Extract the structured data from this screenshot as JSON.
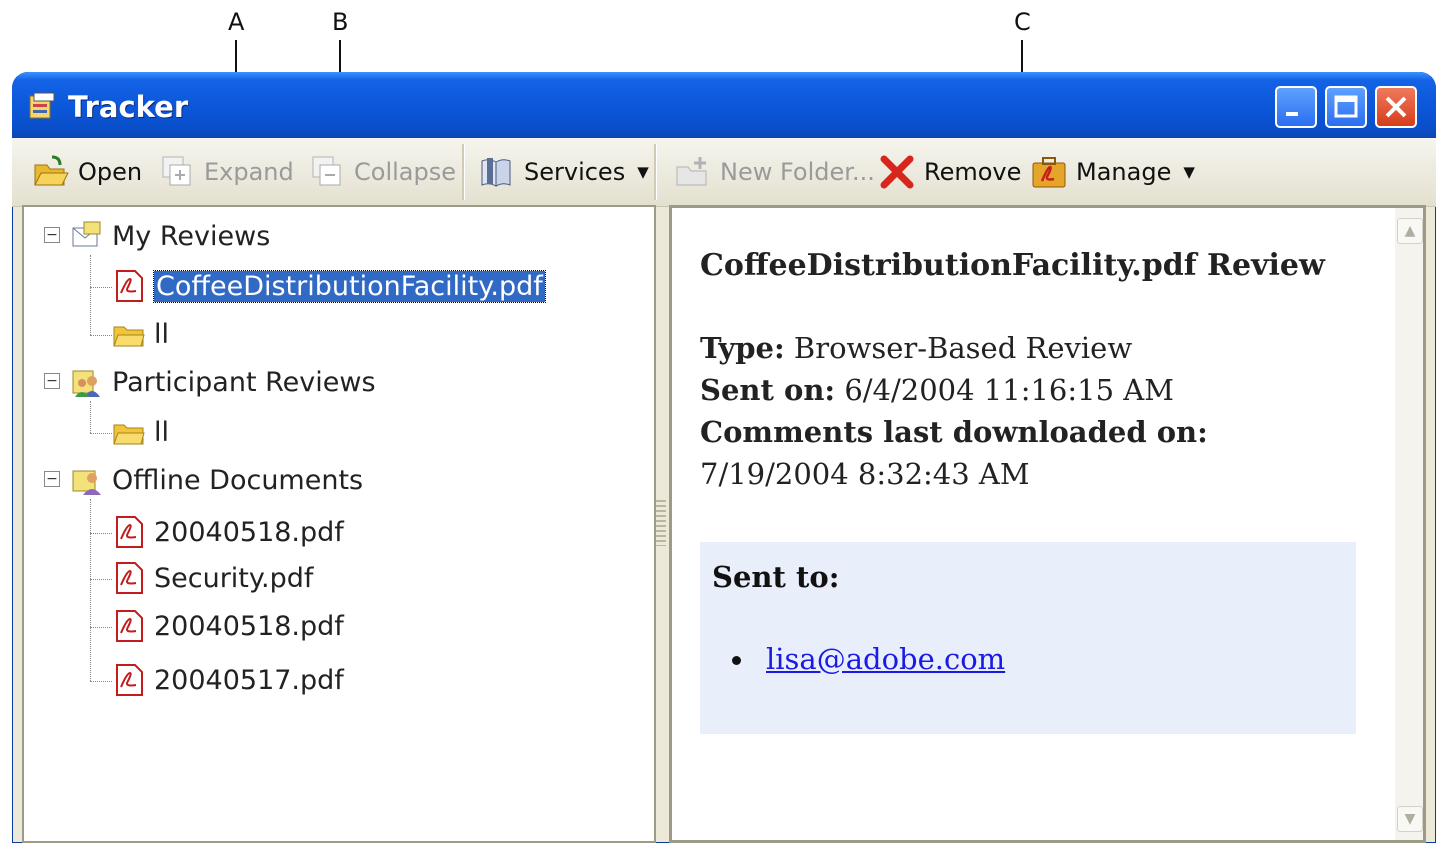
{
  "callouts": {
    "a": "A",
    "b": "B",
    "c": "C"
  },
  "window": {
    "title": "Tracker"
  },
  "toolbar": {
    "open": "Open",
    "expand": "Expand",
    "collapse": "Collapse",
    "services": "Services",
    "new_folder": "New Folder...",
    "remove": "Remove",
    "manage": "Manage"
  },
  "tree": {
    "my_reviews": {
      "label": "My Reviews",
      "children": [
        "CoffeeDistributionFacility.pdf",
        "ll"
      ]
    },
    "participant_reviews": {
      "label": "Participant Reviews",
      "children": [
        "ll"
      ]
    },
    "offline_documents": {
      "label": "Offline Documents",
      "children": [
        "20040518.pdf",
        "Security.pdf",
        "20040518.pdf",
        "20040517.pdf"
      ]
    }
  },
  "details": {
    "title": "CoffeeDistributionFacility.pdf Review",
    "type_label": "Type:",
    "type_value": "Browser-Based Review",
    "sent_on_label": "Sent on:",
    "sent_on_value": "6/4/2004 11:16:15 AM",
    "comments_label": "Comments last downloaded on:",
    "comments_value": "7/19/2004 8:32:43 AM",
    "sent_to_label": "Sent to:",
    "recipients": [
      "lisa@adobe.com"
    ]
  },
  "colors": {
    "title_bar": "#0b56d9",
    "selection": "#316ac5",
    "link": "#1a1ae6",
    "sent_box": "#e9eefb"
  }
}
